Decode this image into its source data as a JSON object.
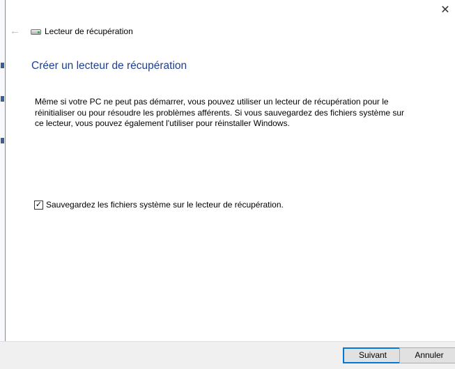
{
  "window": {
    "title": "Lecteur de récupération",
    "close_label": "✕",
    "back_label": "←"
  },
  "page": {
    "heading": "Créer un lecteur de récupération",
    "description": "Même si votre PC ne peut pas démarrer, vous pouvez utiliser un lecteur de récupération pour le réinitialiser ou pour résoudre les problèmes afférents. Si vous sauvegardez des fichiers système sur ce lecteur, vous pouvez également l'utiliser pour réinstaller Windows.",
    "checkbox": {
      "label": "Sauvegardez les fichiers système sur le lecteur de récupération.",
      "checked": true,
      "mark": "✓"
    }
  },
  "footer": {
    "next_label": "Suivant",
    "cancel_label": "Annuler"
  },
  "colors": {
    "heading": "#1c3f94",
    "accent": "#0078d7"
  }
}
